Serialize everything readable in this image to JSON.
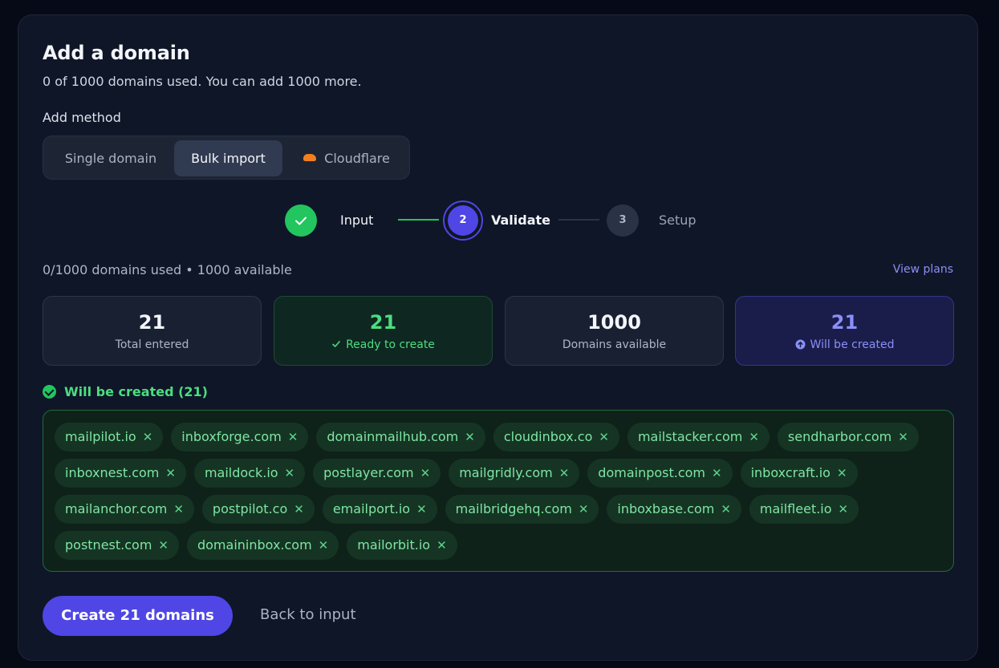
{
  "header": {
    "title": "Add a domain",
    "subtitle": "0 of 1000 domains used. You can add 1000 more."
  },
  "add_method": {
    "label": "Add method",
    "options": [
      "Single domain",
      "Bulk import",
      "Cloudflare"
    ],
    "selected": "Bulk import"
  },
  "stepper": {
    "steps": [
      {
        "label": "Input",
        "marker": "✓",
        "state": "done"
      },
      {
        "label": "Validate",
        "marker": "2",
        "state": "active"
      },
      {
        "label": "Setup",
        "marker": "3",
        "state": "pending"
      }
    ]
  },
  "usage": {
    "text": "0/1000 domains used • 1000 available",
    "view_plans": "View plans"
  },
  "stats": [
    {
      "value": "21",
      "label": "Total entered",
      "icon": "",
      "color": "#f3f5fa"
    },
    {
      "value": "21",
      "label": "Ready to create",
      "icon": "check-icon",
      "color": "#4ade80"
    },
    {
      "value": "1000",
      "label": "Domains available",
      "icon": "",
      "color": "#f3f5fa"
    },
    {
      "value": "21",
      "label": "Will be created",
      "icon": "arrow-up-circle-icon",
      "color": "#8b8ff7"
    }
  ],
  "will_be_created": {
    "heading": "Will be created (21)",
    "domains": [
      "mailpilot.io",
      "inboxforge.com",
      "domainmailhub.com",
      "cloudinbox.co",
      "mailstacker.com",
      "sendharbor.com",
      "inboxnest.com",
      "maildock.io",
      "postlayer.com",
      "mailgridly.com",
      "domainpost.com",
      "inboxcraft.io",
      "mailanchor.com",
      "postpilot.co",
      "emailport.io",
      "mailbridgehq.com",
      "inboxbase.com",
      "mailfleet.io",
      "postnest.com",
      "domaininbox.com",
      "mailorbit.io"
    ]
  },
  "actions": {
    "create": "Create 21 domains",
    "back": "Back to input"
  },
  "colors": {
    "accent": "#4f46e5",
    "success": "#22c55e",
    "background": "#0f1627"
  }
}
